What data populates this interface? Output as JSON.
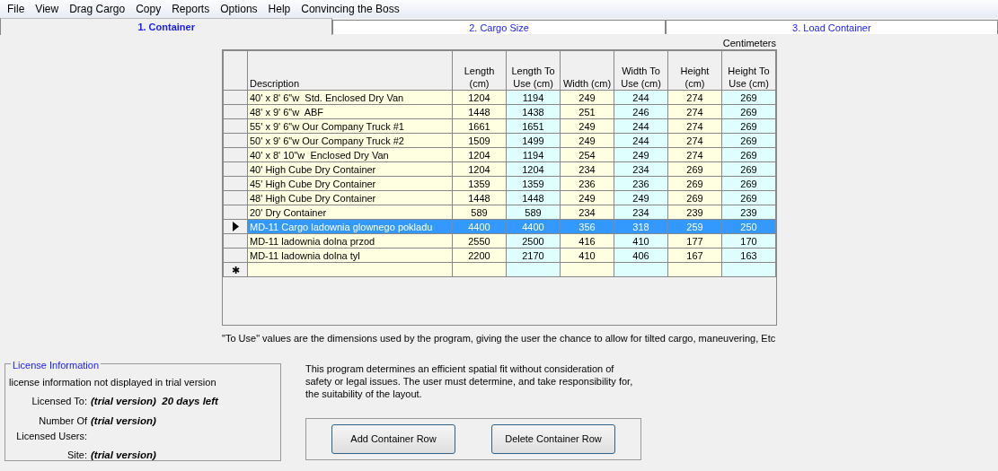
{
  "menu": [
    "File",
    "View",
    "Drag Cargo",
    "Copy",
    "Reports",
    "Options",
    "Help",
    "Convincing the Boss"
  ],
  "tabs": [
    {
      "label": "1. Container",
      "selected": true
    },
    {
      "label": "2. Cargo Size",
      "selected": false
    },
    {
      "label": "3. Load Container",
      "selected": false
    }
  ],
  "units_label": "Centimeters",
  "table": {
    "columns": [
      {
        "label": "Description",
        "kind": "text"
      },
      {
        "label": "Length (cm)",
        "kind": "plain"
      },
      {
        "label": "Length To Use (cm)",
        "kind": "to_use"
      },
      {
        "label": "Width (cm)",
        "kind": "plain"
      },
      {
        "label": "Width To Use (cm)",
        "kind": "to_use"
      },
      {
        "label": "Height (cm)",
        "kind": "plain"
      },
      {
        "label": "Height To Use (cm)",
        "kind": "to_use"
      }
    ],
    "rows": [
      {
        "cells": [
          "40' x 8' 6\"w  Std. Enclosed Dry Van",
          "1204",
          "1194",
          "249",
          "244",
          "274",
          "269"
        ],
        "selected": false
      },
      {
        "cells": [
          "48' x 9' 6\"w  ABF",
          "1448",
          "1438",
          "251",
          "246",
          "274",
          "269"
        ],
        "selected": false
      },
      {
        "cells": [
          "55' x 9' 6\"w Our Company Truck #1",
          "1661",
          "1651",
          "249",
          "244",
          "274",
          "269"
        ],
        "selected": false
      },
      {
        "cells": [
          "50' x 9' 6\"w Our Company Truck #2",
          "1509",
          "1499",
          "249",
          "244",
          "274",
          "269"
        ],
        "selected": false
      },
      {
        "cells": [
          "40' x 8' 10\"w  Enclosed Dry Van",
          "1204",
          "1194",
          "254",
          "249",
          "274",
          "269"
        ],
        "selected": false
      },
      {
        "cells": [
          "40' High Cube Dry Container",
          "1204",
          "1204",
          "234",
          "234",
          "269",
          "269"
        ],
        "selected": false
      },
      {
        "cells": [
          "45' High Cube Dry Container",
          "1359",
          "1359",
          "236",
          "236",
          "269",
          "269"
        ],
        "selected": false
      },
      {
        "cells": [
          "48' High Cube Dry Container",
          "1448",
          "1448",
          "249",
          "249",
          "269",
          "269"
        ],
        "selected": false
      },
      {
        "cells": [
          "20' Dry Container",
          "589",
          "589",
          "234",
          "234",
          "239",
          "239"
        ],
        "selected": false
      },
      {
        "cells": [
          "MD-11 Cargo ladownia glownego pokladu",
          "4400",
          "4400",
          "356",
          "318",
          "259",
          "250"
        ],
        "selected": true
      },
      {
        "cells": [
          "MD-11 ladownia dolna przod",
          "2550",
          "2500",
          "416",
          "410",
          "177",
          "170"
        ],
        "selected": false
      },
      {
        "cells": [
          "MD-11 ladownia dolna tyl",
          "2200",
          "2170",
          "410",
          "406",
          "167",
          "163"
        ],
        "selected": false
      }
    ],
    "new_row_marker": "✱"
  },
  "table_note": "\"To Use\" values are the dimensions used by the program, giving the user the chance to allow  for tilted cargo, maneuvering, Etc",
  "license": {
    "legend": "License Information",
    "note": "license information not displayed in trial version",
    "fields": [
      {
        "label": "Licensed To:",
        "value": "(trial version)  20 days left"
      },
      {
        "label": "Number Of Licensed Users:",
        "value": "(trial version)"
      },
      {
        "label": "Site:",
        "value": "(trial version)"
      }
    ]
  },
  "disclaimer": "This program determines an efficient spatial fit without consideration of safety or legal issues. The user must determine, and take responsibility for, the suitability of the layout.",
  "buttons": [
    "Add Container Row",
    "Delete Container Row"
  ]
}
